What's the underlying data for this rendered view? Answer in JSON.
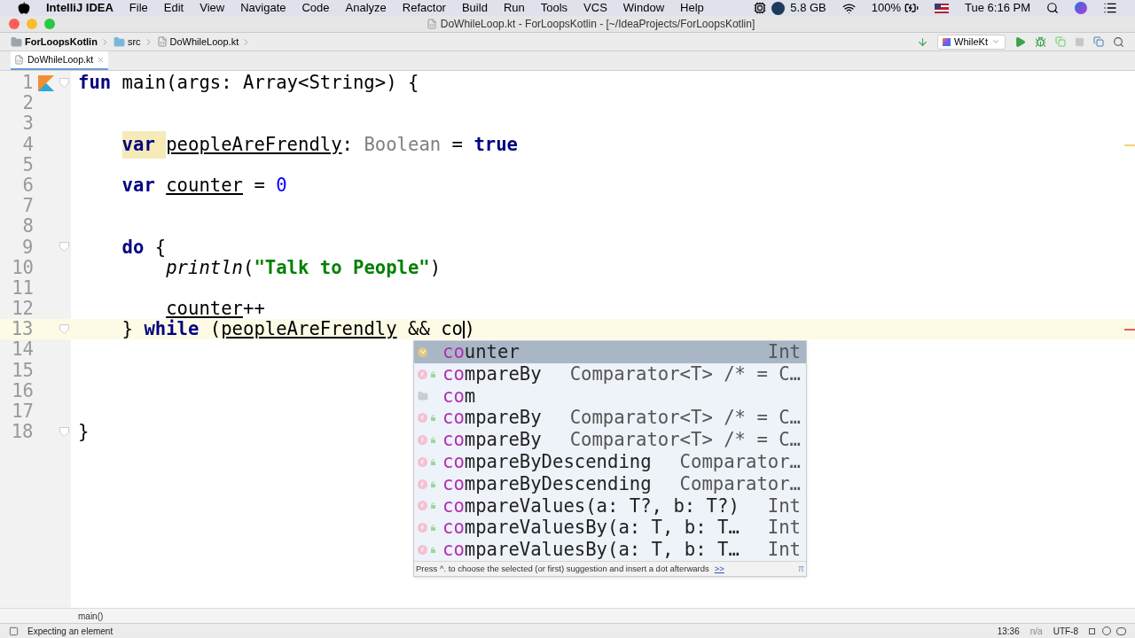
{
  "menu_bar": {
    "app": "IntelliJ IDEA",
    "items": [
      "File",
      "Edit",
      "View",
      "Navigate",
      "Code",
      "Analyze",
      "Refactor",
      "Build",
      "Run",
      "Tools",
      "VCS",
      "Window",
      "Help"
    ],
    "memory": "5.8 GB",
    "battery": "100%",
    "clock": "Tue 6:16 PM"
  },
  "window": {
    "title": "DoWhileLoop.kt - ForLoopsKotlin - [~/IdeaProjects/ForLoopsKotlin]"
  },
  "breadcrumbs": [
    {
      "label": "ForLoopsKotlin",
      "kind": "project"
    },
    {
      "label": "src",
      "kind": "folder"
    },
    {
      "label": "DoWhileLoop.kt",
      "kind": "file"
    }
  ],
  "run_config": "WhileKt",
  "tabs": [
    {
      "label": "DoWhileLoop.kt",
      "selected": true
    }
  ],
  "lines": [
    {
      "n": "1",
      "run_icon": true,
      "fold": true,
      "current": false,
      "tokens": [
        {
          "kind": "keyword",
          "text": "fun"
        },
        {
          "kind": "plain",
          "text": " main(args: Array<String>) {"
        }
      ],
      "children": [
        {
          "n": "2",
          "run_icon": false,
          "fold": false,
          "current": false
        },
        {
          "n": "3",
          "run_icon": false,
          "fold": false,
          "current": false
        },
        {
          "n": "4",
          "run_icon": false,
          "fold": false,
          "current": false,
          "tokens": [
            {
              "kind": "marked_keyword",
              "text": "var "
            },
            {
              "kind": "variable",
              "text": "peopleAreFrendly"
            },
            {
              "kind": "plain",
              "text": ": "
            },
            {
              "kind": "type",
              "text": "Boolean"
            },
            {
              "kind": "plain",
              "text": " = "
            },
            {
              "kind": "keyword",
              "text": "true"
            }
          ]
        },
        {
          "n": "5",
          "run_icon": false,
          "fold": false,
          "current": false
        },
        {
          "n": "6",
          "run_icon": false,
          "fold": false,
          "current": false,
          "tokens": [
            {
              "kind": "keyword",
              "text": "var "
            },
            {
              "kind": "variable",
              "text": "counter"
            },
            {
              "kind": "plain",
              "text": " = "
            },
            {
              "kind": "number",
              "text": "0"
            }
          ]
        },
        {
          "n": "7",
          "run_icon": false,
          "fold": false,
          "current": false
        },
        {
          "n": "8",
          "run_icon": false,
          "fold": false,
          "current": false
        },
        {
          "n": "9",
          "run_icon": false,
          "fold": true,
          "current": false,
          "tokens": [
            {
              "kind": "keyword",
              "text": "do"
            },
            {
              "kind": "plain",
              "text": " {"
            }
          ],
          "children": [
            {
              "n": "10",
              "run_icon": false,
              "fold": false,
              "current": false,
              "tokens": [
                {
                  "kind": "call",
                  "text": "println"
                },
                {
                  "kind": "plain",
                  "text": "("
                },
                {
                  "kind": "string",
                  "text": "\"Talk to People\""
                },
                {
                  "kind": "plain",
                  "text": ")"
                }
              ]
            },
            {
              "n": "11",
              "run_icon": false,
              "fold": false,
              "current": false
            },
            {
              "n": "12",
              "run_icon": false,
              "fold": false,
              "current": false,
              "tokens": [
                {
                  "kind": "variable",
                  "text": "counter"
                },
                {
                  "kind": "plain",
                  "text": "++"
                }
              ]
            }
          ]
        },
        {
          "n": "13",
          "run_icon": false,
          "fold": true,
          "current": true,
          "tokens": [
            {
              "kind": "plain",
              "text": "} "
            },
            {
              "kind": "keyword",
              "text": "while"
            },
            {
              "kind": "plain",
              "text": " ("
            },
            {
              "kind": "variable",
              "text": "peopleAreFrendly"
            },
            {
              "kind": "plain",
              "text": " && co"
            },
            {
              "kind": "caret"
            },
            {
              "kind": "plain",
              "text": ")"
            }
          ]
        },
        {
          "n": "14",
          "run_icon": false,
          "fold": false,
          "current": false
        },
        {
          "n": "15",
          "run_icon": false,
          "fold": false,
          "current": false
        },
        {
          "n": "16",
          "run_icon": false,
          "fold": false,
          "current": false
        },
        {
          "n": "17",
          "run_icon": false,
          "fold": false,
          "current": false
        }
      ]
    },
    {
      "n": "18",
      "run_icon": false,
      "fold": true,
      "current": false,
      "tokens": [
        {
          "kind": "plain",
          "text": "}"
        }
      ]
    }
  ],
  "completion": {
    "items": [
      {
        "kind": "variable",
        "match": "co",
        "rest": "unter",
        "type": "Int",
        "selected": true
      },
      {
        "kind": "function",
        "match": "co",
        "rest": "mpareBy",
        "type": "Comparator<T> /* = C…",
        "selected": false
      },
      {
        "kind": "package",
        "match": "co",
        "rest": "m",
        "selected": false
      },
      {
        "kind": "function",
        "match": "co",
        "rest": "mpareBy",
        "type": "Comparator<T> /* = C…",
        "selected": false
      },
      {
        "kind": "function",
        "match": "co",
        "rest": "mpareBy",
        "type": "Comparator<T> /* = C…",
        "selected": false
      },
      {
        "kind": "function",
        "match": "co",
        "rest": "mpareByDescending",
        "type": "Comparator…",
        "selected": false
      },
      {
        "kind": "function",
        "match": "co",
        "rest": "mpareByDescending",
        "type": "Comparator…",
        "selected": false
      },
      {
        "kind": "function",
        "match": "co",
        "rest": "mpareValues(a: T?, b: T?)",
        "type": "Int",
        "selected": false
      },
      {
        "kind": "function",
        "match": "co",
        "rest": "mpareValuesBy(a: T, b: T…",
        "type": "Int",
        "selected": false
      },
      {
        "kind": "function",
        "match": "co",
        "rest": "mpareValuesBy(a: T, b: T…",
        "type": "Int",
        "selected": false
      }
    ],
    "hint": "Press ^. to choose the selected (or first) suggestion and insert a dot afterwards",
    "hint_link": ">>",
    "pi": "π"
  },
  "structure_path": "main()",
  "status_bar": {
    "message": "Expecting an element",
    "position": "13:36",
    "vcs": "n/a",
    "encoding": "UTF-8"
  }
}
